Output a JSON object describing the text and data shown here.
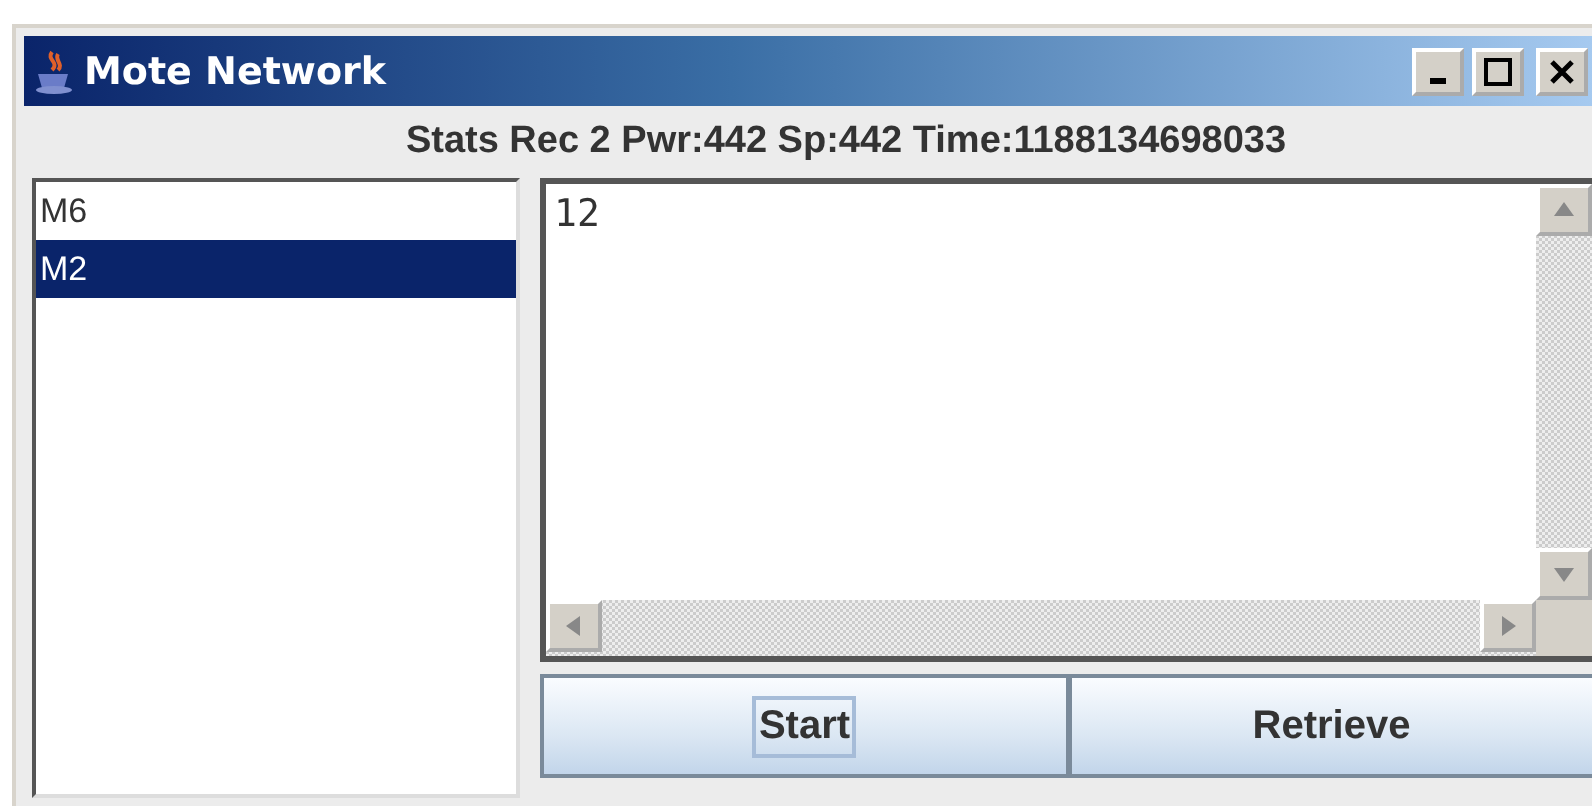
{
  "window": {
    "title": "Mote Network"
  },
  "status": "Stats Rec 2 Pwr:442 Sp:442 Time:1188134698033",
  "motes": [
    {
      "label": "M6",
      "selected": false
    },
    {
      "label": "M2",
      "selected": true
    }
  ],
  "output": {
    "value": "12"
  },
  "buttons": [
    {
      "label": "Start",
      "focused": true
    },
    {
      "label": "Retrieve",
      "focused": false
    }
  ]
}
